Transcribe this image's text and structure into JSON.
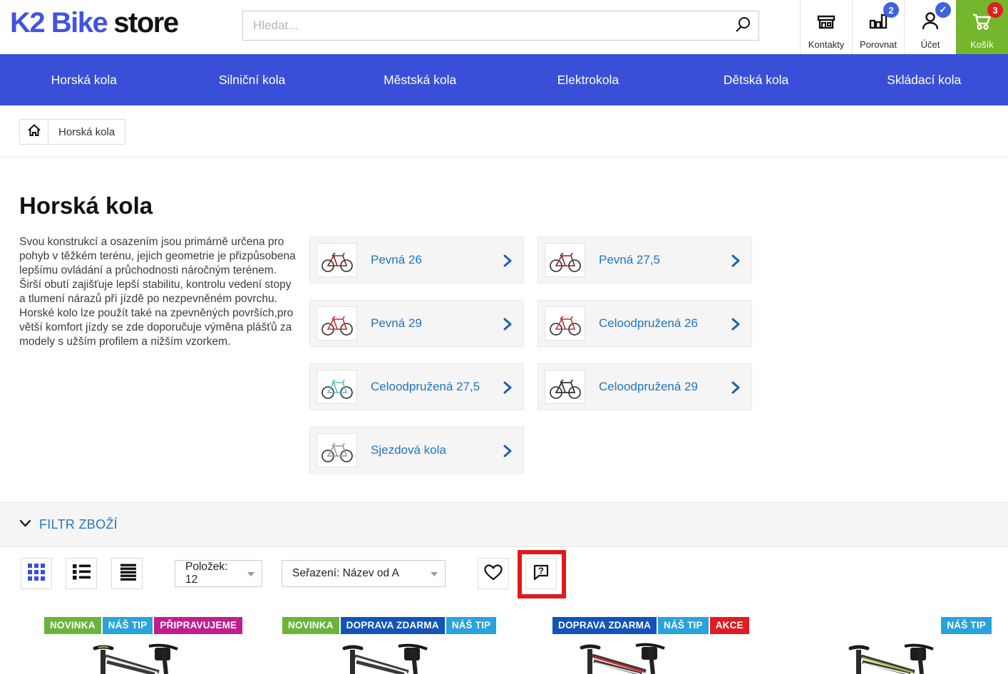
{
  "header": {
    "logo_part1": "K2 Bike",
    "logo_part2": "store",
    "search_placeholder": "Hledat...",
    "actions": [
      {
        "label": "Kontakty",
        "icon": "storefront-icon",
        "badge": ""
      },
      {
        "label": "Porovnat",
        "icon": "bar-chart-icon",
        "badge": "2"
      },
      {
        "label": "Účet",
        "icon": "user-icon",
        "badge": "✓"
      },
      {
        "label": "Košík",
        "icon": "cart-icon",
        "badge": "3"
      }
    ]
  },
  "nav": {
    "items": [
      "Horská kola",
      "Silniční kola",
      "Městská kola",
      "Elektrokola",
      "Dětská kola",
      "Skládací kola"
    ]
  },
  "breadcrumb": {
    "current": "Horská kola"
  },
  "page": {
    "title": "Horská kola",
    "description": "Svou konstrukcí a osazením jsou primárně určena pro pohyb v těžkém terénu, jejich geometrie je přizpůsobena lepšímu ovládání a průchodnosti náročným terénem. Širší obutí zajišťuje lepší stabilitu, kontrolu vedení stopy a tlumení nárazů pří jízdě po nezpevněném povrchu. Horské kolo lze použít také na zpevněných površích,pro větší komfort jízdy se zde doporučuje výměna plášťů za modely s užším profilem a nižším vzorkem."
  },
  "categories": [
    {
      "label": "Pevná 26"
    },
    {
      "label": "Pevná 27,5"
    },
    {
      "label": "Pevná 29"
    },
    {
      "label": "Celoodpružená 26"
    },
    {
      "label": "Celoodpružená 27,5"
    },
    {
      "label": "Celoodpružená 29"
    },
    {
      "label": "Sjezdová kola"
    }
  ],
  "filter": {
    "label": "FILTR ZBOŽÍ"
  },
  "toolbar": {
    "items_dropdown": "Položek: 12",
    "sort_dropdown": "Seřazení: Název od A"
  },
  "products": [
    {
      "badges": [
        {
          "text": "NOVINKA",
          "color": "#6cb33c"
        },
        {
          "text": "NÁŠ TIP",
          "color": "#29a3db"
        },
        {
          "text": "PŘIPRAVUJEME",
          "color": "#c01d8e"
        }
      ]
    },
    {
      "badges": [
        {
          "text": "NOVINKA",
          "color": "#6cb33c"
        },
        {
          "text": "DOPRAVA ZDARMA",
          "color": "#1254b8"
        },
        {
          "text": "NÁŠ TIP",
          "color": "#29a3db"
        }
      ]
    },
    {
      "badges": [
        {
          "text": "DOPRAVA ZDARMA",
          "color": "#1254b8"
        },
        {
          "text": "NÁŠ TIP",
          "color": "#29a3db"
        },
        {
          "text": "AKCE",
          "color": "#dd1d21"
        }
      ]
    },
    {
      "badges": [
        {
          "text": "NÁŠ TIP",
          "color": "#29a3db"
        }
      ]
    }
  ],
  "colors": {
    "nav_blue": "#3a4fd8",
    "logo_blue": "#4253e0",
    "link_blue": "#1d76c2",
    "filter_blue": "#2176c7",
    "cart_green": "#74b62c",
    "header_badge_blue": "#3e63e0",
    "header_badge_red": "#e02020",
    "annotation_red": "#e0191c"
  }
}
